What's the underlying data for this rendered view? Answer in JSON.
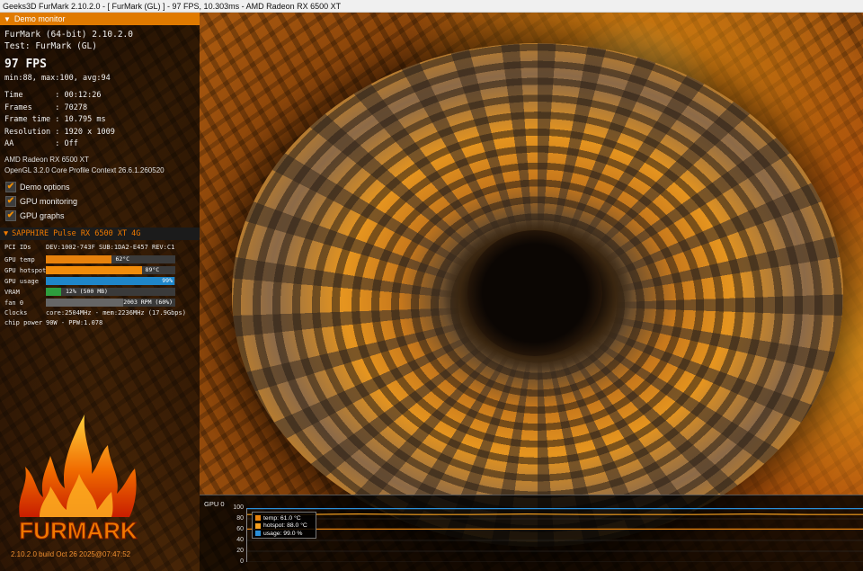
{
  "window": {
    "title": "Geeks3D FurMark 2.10.2.0 - [ FurMark (GL) ] - 97 FPS, 10.303ms - AMD Radeon RX 6500 XT"
  },
  "panel": {
    "header": "Demo monitor",
    "app_line": "FurMark (64-bit) 2.10.2.0",
    "test_line": "Test: FurMark (GL)",
    "fps": "97 FPS",
    "fps_stats": "min:88, max:100, avg:94",
    "stats": [
      {
        "label": "Time       : 00:12:26"
      },
      {
        "label": "Frames     : 70278"
      },
      {
        "label": "Frame time : 10.795 ms"
      },
      {
        "label": "Resolution : 1920 x 1009"
      },
      {
        "label": "AA         : Off"
      }
    ],
    "gpu_name": "AMD Radeon RX 6500 XT",
    "gl_context": "OpenGL 3.2.0 Core Profile Context 26.6.1.260520",
    "options": [
      {
        "label": "Demo options",
        "checked": true
      },
      {
        "label": "GPU monitoring",
        "checked": true
      },
      {
        "label": "GPU graphs",
        "checked": true
      }
    ]
  },
  "gpu_monitor": {
    "header": "SAPPHIRE Pulse RX 6500 XT 4G",
    "pci_label": "PCI IDs",
    "pci_value": "DEV:1002-743F SUB:1DA2-E457 REV:C1",
    "rows": [
      {
        "label": "GPU temp",
        "text": "62°C",
        "fraction": 0.51,
        "color": "#e8820c"
      },
      {
        "label": "GPU hotspot",
        "text": "89°C",
        "fraction": 0.74,
        "color": "#f28c0a"
      },
      {
        "label": "GPU usage",
        "text": "99%",
        "fraction": 0.99,
        "color": "#1f86c9"
      },
      {
        "label": "VRAM",
        "text": "12% (500 MB)",
        "fraction": 0.12,
        "color": "#2e9e3e"
      },
      {
        "label": "fan 0",
        "text": "2003 RPM (60%)",
        "fraction": 0.6,
        "color": "#666666"
      }
    ],
    "clocks_label": "Clocks",
    "clocks_value": "core:2504MHz - mem:2236MHz (17.9Gbps)",
    "power_label": "chip power",
    "power_value": "90W - PPW:1.078"
  },
  "build": "2.10.2.0 build Oct 26 2025@07:47:52",
  "logo_text": "FURMARK",
  "graph": {
    "title": "GPU 0",
    "yticks": [
      "100",
      "80",
      "60",
      "40",
      "20",
      "0"
    ],
    "legend": [
      {
        "label": "temp: 61.0 °C",
        "color": "#e8820c"
      },
      {
        "label": "hotspot: 88.0 °C",
        "color": "#f5a020"
      },
      {
        "label": "usage: 99.0 %",
        "color": "#2a8fd8"
      }
    ]
  },
  "chart_data": {
    "type": "line",
    "title": "GPU 0",
    "ylim": [
      0,
      100
    ],
    "series": [
      {
        "name": "temp",
        "values": [
          61,
          61,
          61,
          61,
          61,
          61,
          61,
          61,
          61,
          61,
          61,
          61
        ]
      },
      {
        "name": "hotspot",
        "values": [
          88,
          88,
          89,
          88,
          88,
          89,
          88,
          88,
          88,
          89,
          88,
          88
        ]
      },
      {
        "name": "usage",
        "values": [
          99,
          99,
          99,
          99,
          99,
          99,
          99,
          99,
          99,
          99,
          99,
          99
        ]
      }
    ]
  }
}
